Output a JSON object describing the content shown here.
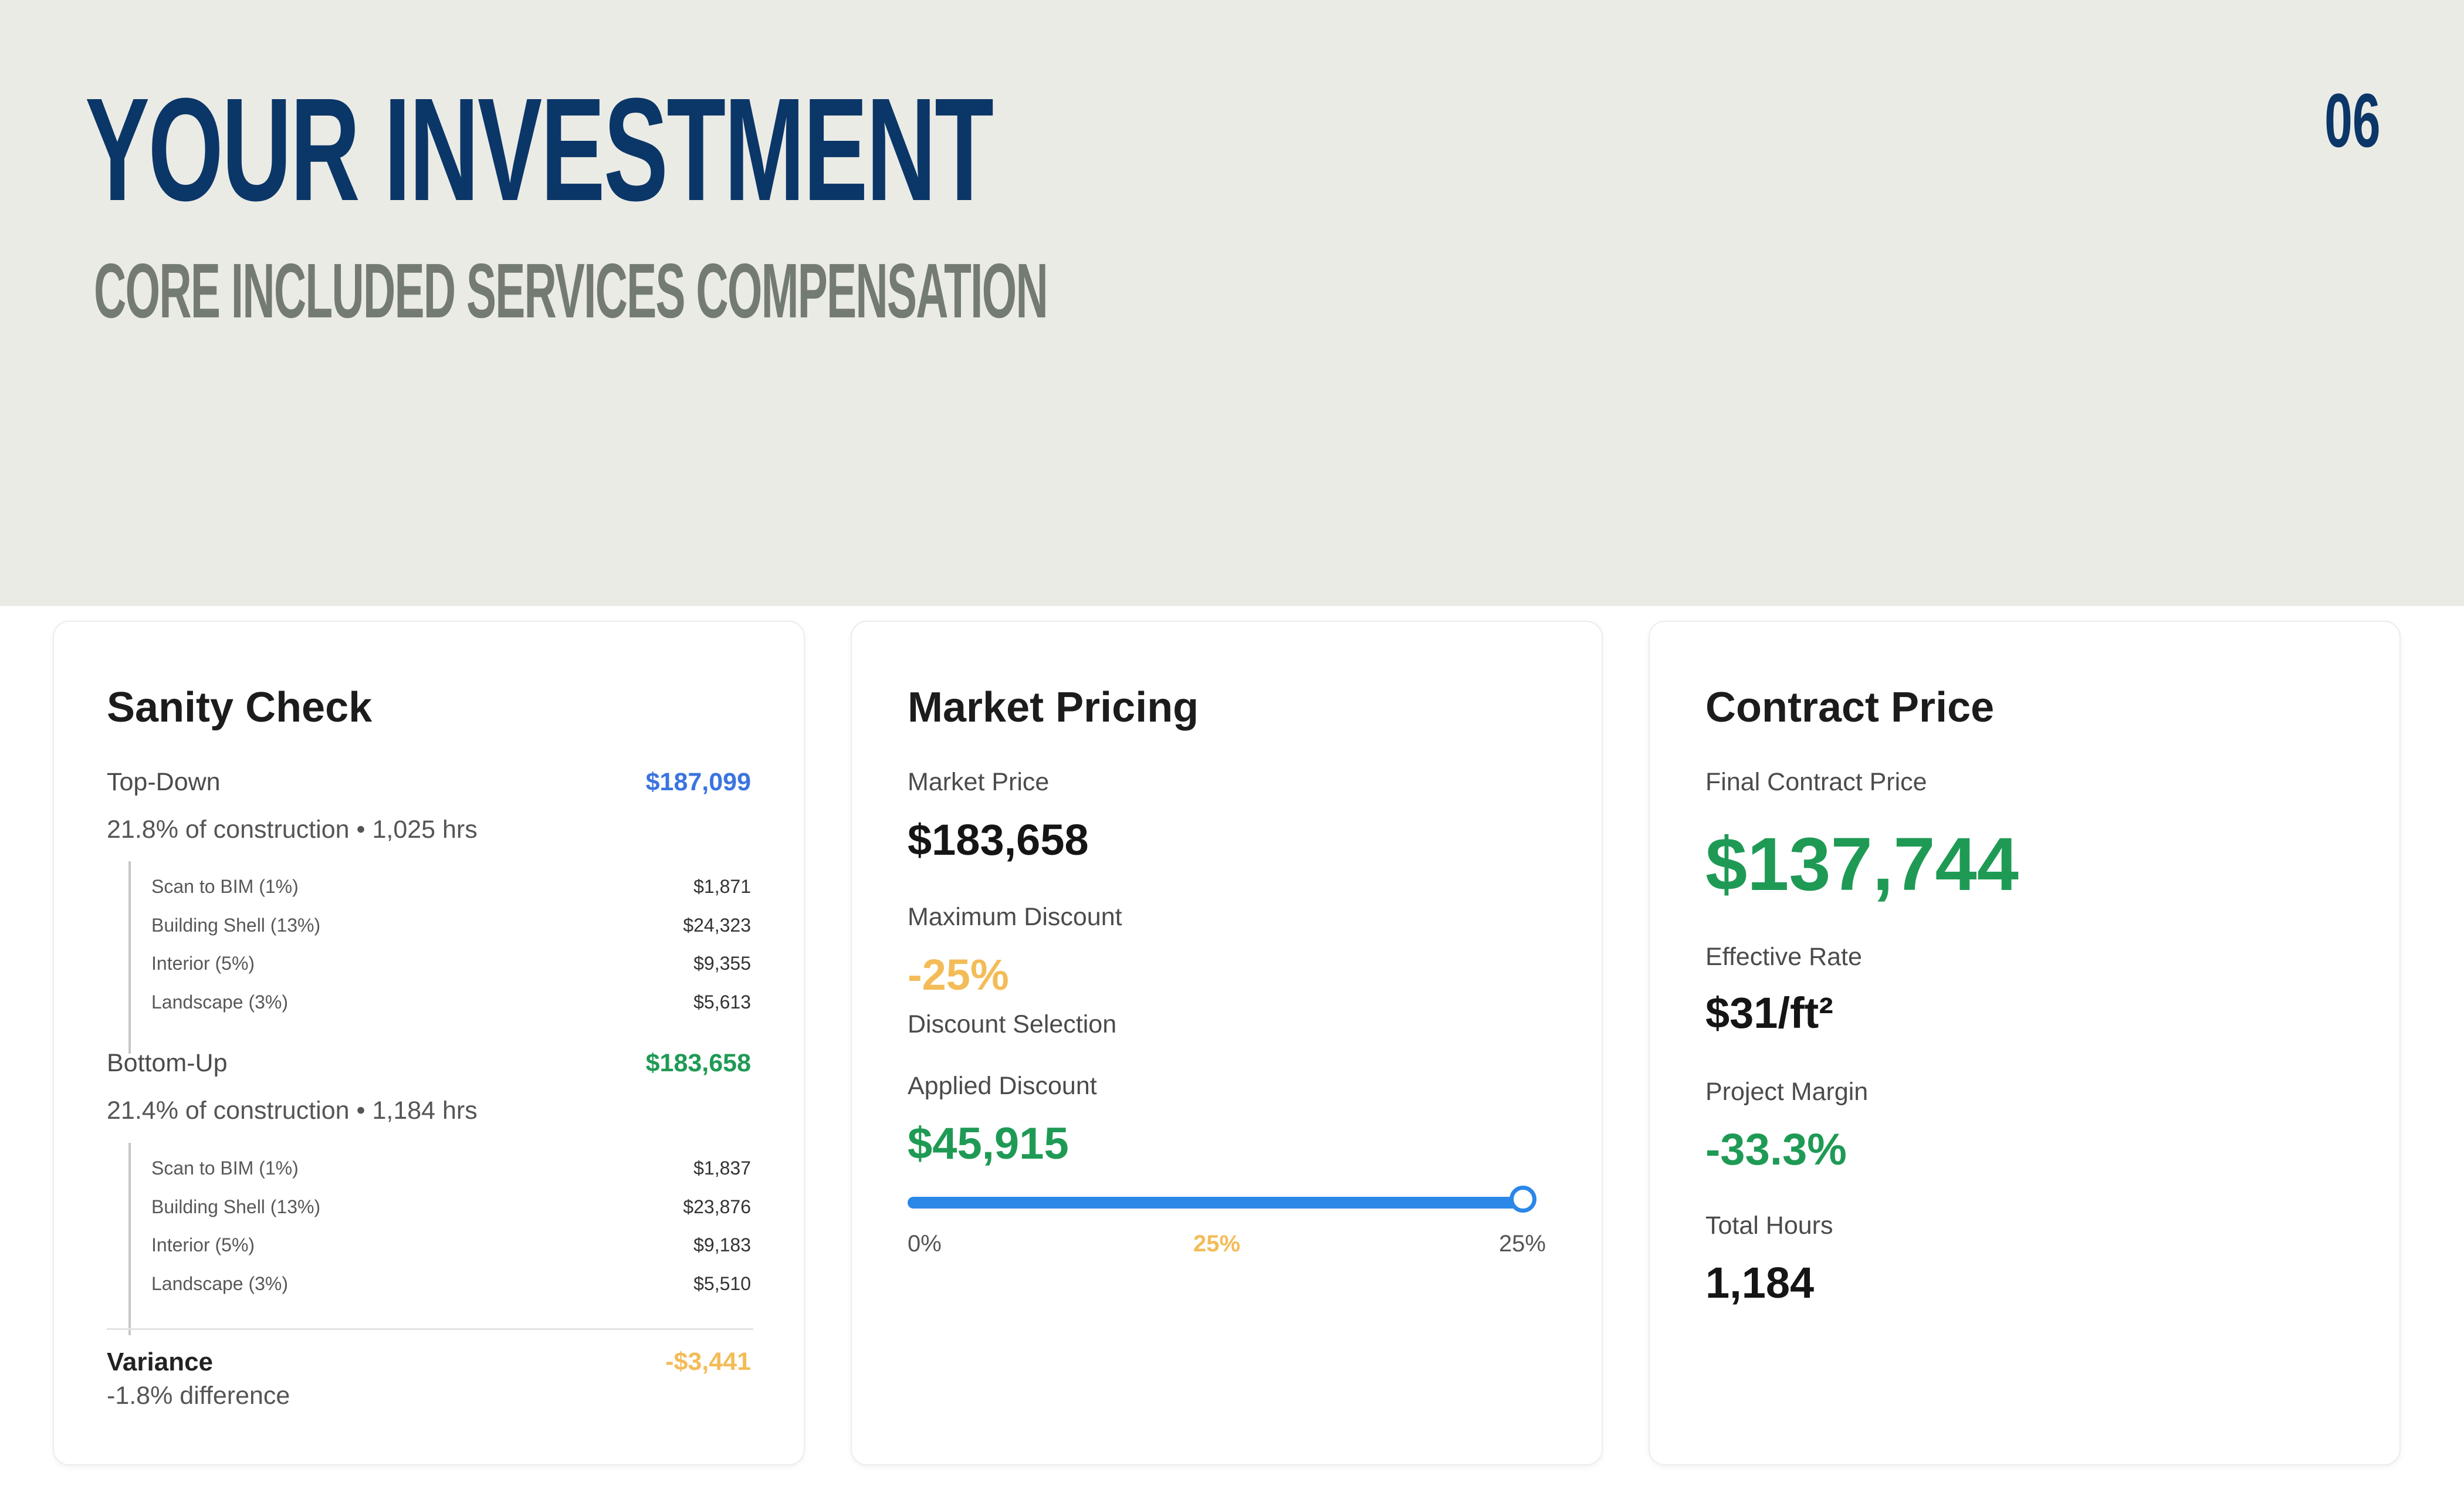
{
  "header": {
    "title": "YOUR INVESTMENT",
    "subtitle": "CORE INCLUDED SERVICES COMPENSATION",
    "page_number": "06"
  },
  "sanity_check": {
    "title": "Sanity Check",
    "top_down": {
      "label": "Top-Down",
      "amount": "$187,099",
      "summary": "21.8% of construction • 1,025 hrs",
      "items": [
        {
          "label": "Scan to BIM (1%)",
          "value": "$1,871"
        },
        {
          "label": "Building Shell (13%)",
          "value": "$24,323"
        },
        {
          "label": "Interior (5%)",
          "value": "$9,355"
        },
        {
          "label": "Landscape (3%)",
          "value": "$5,613"
        }
      ]
    },
    "bottom_up": {
      "label": "Bottom-Up",
      "amount": "$183,658",
      "summary": "21.4% of construction • 1,184 hrs",
      "items": [
        {
          "label": "Scan to BIM (1%)",
          "value": "$1,837"
        },
        {
          "label": "Building Shell (13%)",
          "value": "$23,876"
        },
        {
          "label": "Interior (5%)",
          "value": "$9,183"
        },
        {
          "label": "Landscape (3%)",
          "value": "$5,510"
        }
      ]
    },
    "variance": {
      "label": "Variance",
      "amount": "-$3,441",
      "difference": "-1.8% difference"
    }
  },
  "market_pricing": {
    "title": "Market Pricing",
    "market_price_label": "Market Price",
    "market_price": "$183,658",
    "max_discount_label": "Maximum Discount",
    "max_discount": "-25%",
    "discount_selection_label": "Discount Selection",
    "applied_discount_label": "Applied Discount",
    "applied_discount": "$45,915",
    "slider": {
      "value_percent": 25,
      "min_percent": 0,
      "max_percent": 25,
      "min_label": "0%",
      "current_label": "25%",
      "max_label": "25%"
    }
  },
  "contract_price": {
    "title": "Contract Price",
    "final_label": "Final Contract Price",
    "final_value": "$137,744",
    "rate_label": "Effective Rate",
    "rate_value": "$31/ft²",
    "margin_label": "Project Margin",
    "margin_value": "-33.3%",
    "hours_label": "Total Hours",
    "hours_value": "1,184"
  },
  "colors": {
    "navy": "#0b3668",
    "header_bg": "#ebebe5",
    "subtitle_gray": "#737b72",
    "blue": "#3b74e0",
    "green": "#1f9a55",
    "orange": "#f3bc58",
    "slider_blue": "#2b87e8"
  }
}
